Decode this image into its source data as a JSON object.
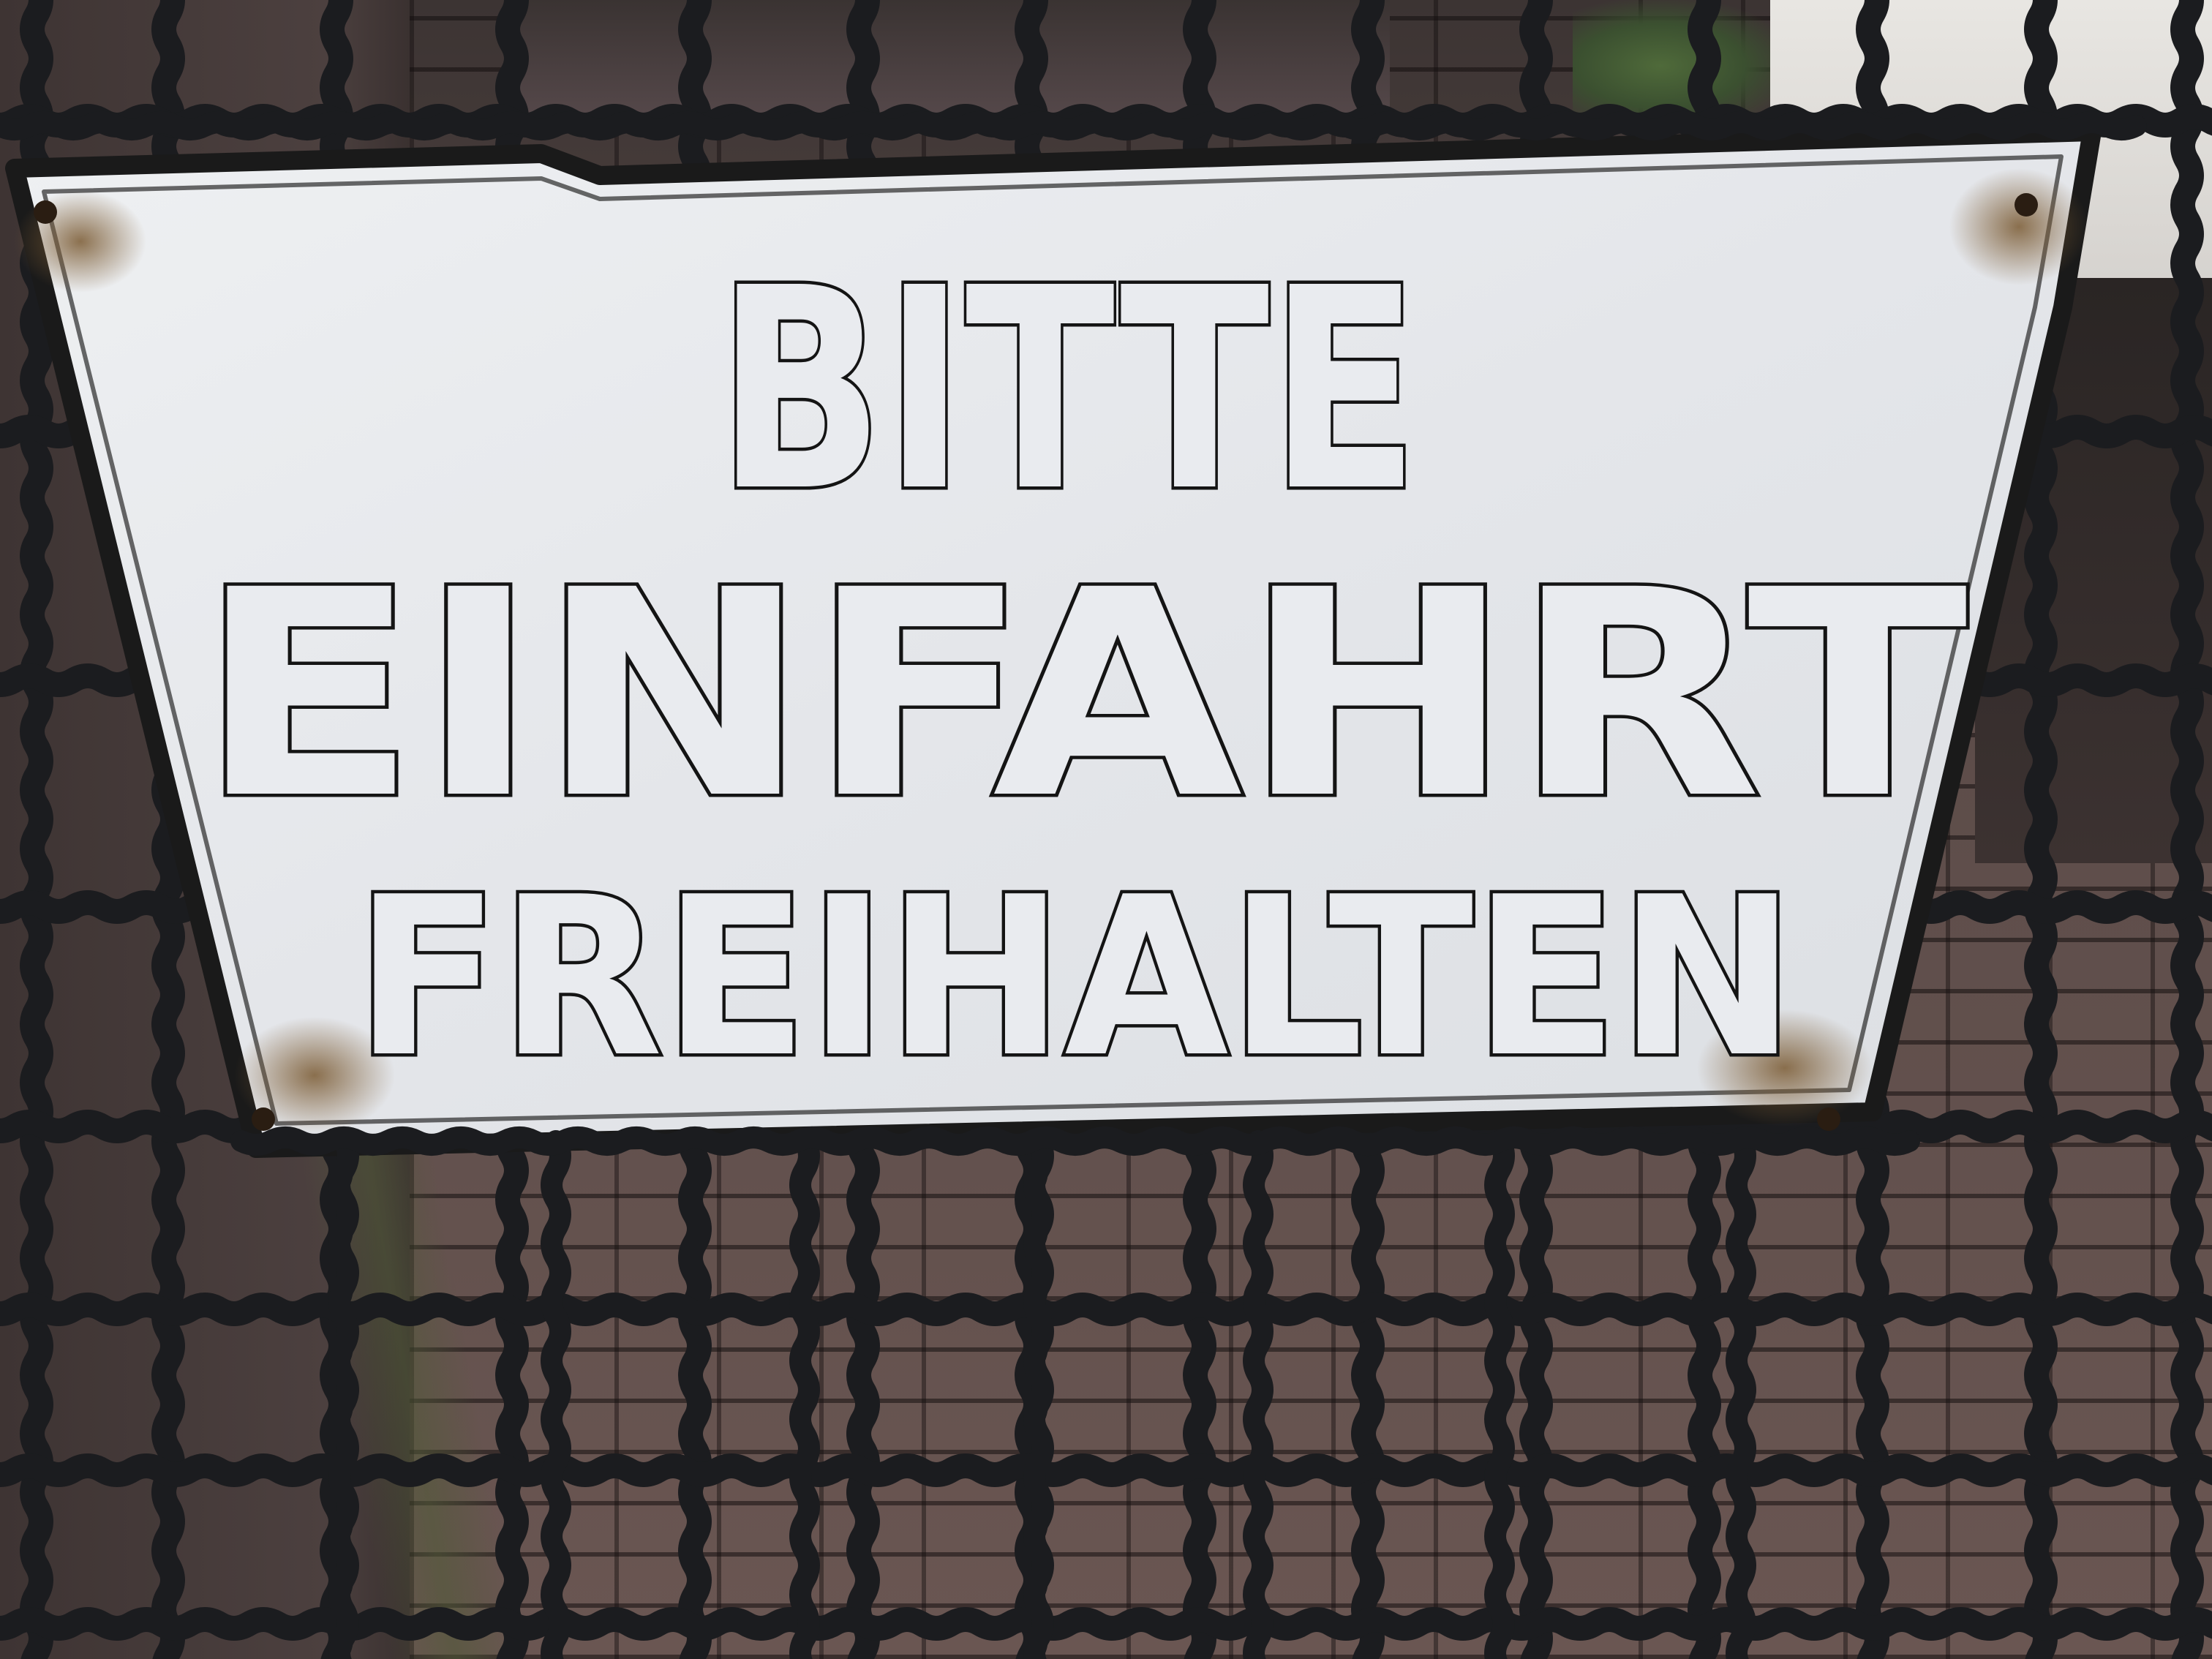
{
  "sign": {
    "line1": "BITTE",
    "line2": "EINFAHRT",
    "line3": "FREIHALTEN"
  },
  "colors": {
    "sign_face": "#e7e9ec",
    "sign_border": "#1a1a1a",
    "lettering_fill": "#e9ebef",
    "lettering_outline": "#141414",
    "fence": "#1b1c1f",
    "pavement": "#5a4a47",
    "rust": "#8a6a3e"
  }
}
